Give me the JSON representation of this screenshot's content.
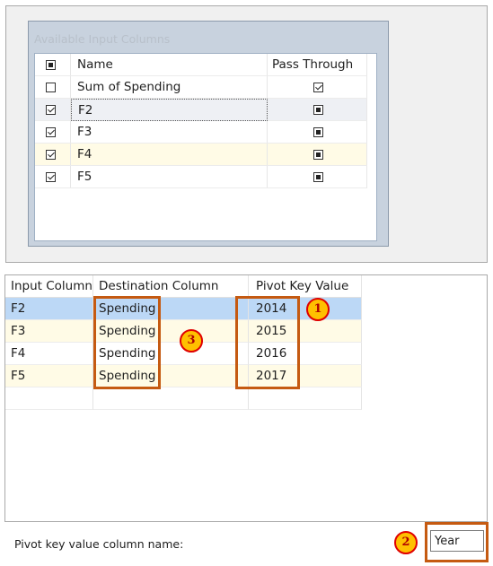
{
  "input_columns": {
    "title": "Available Input Columns",
    "headers": {
      "name": "Name",
      "pass_through": "Pass Through"
    },
    "rows": [
      {
        "name": "Sum of Spending",
        "selected": false,
        "pass_through": true
      },
      {
        "name": "F2",
        "selected": true,
        "pass_through": false
      },
      {
        "name": "F3",
        "selected": true,
        "pass_through": false
      },
      {
        "name": "F4",
        "selected": true,
        "pass_through": false
      },
      {
        "name": "F5",
        "selected": true,
        "pass_through": false
      }
    ]
  },
  "mapping": {
    "headers": {
      "input": "Input Column",
      "destination": "Destination Column",
      "pivot": "Pivot Key Value"
    },
    "rows": [
      {
        "input": "F2",
        "destination": "Spending",
        "pivot": "2014"
      },
      {
        "input": "F3",
        "destination": "Spending",
        "pivot": "2015"
      },
      {
        "input": "F4",
        "destination": "Spending",
        "pivot": "2016"
      },
      {
        "input": "F5",
        "destination": "Spending",
        "pivot": "2017"
      }
    ]
  },
  "pivot_key": {
    "label": "Pivot key value column name:",
    "value": "Year"
  },
  "callouts": {
    "one": "1",
    "two": "2",
    "three": "3"
  },
  "colors": {
    "callout_border": "#c55a11",
    "badge_fill": "#ffc000",
    "badge_border": "#e00000",
    "selection": "#bcd8f6",
    "highlight": "#fffbe6"
  }
}
